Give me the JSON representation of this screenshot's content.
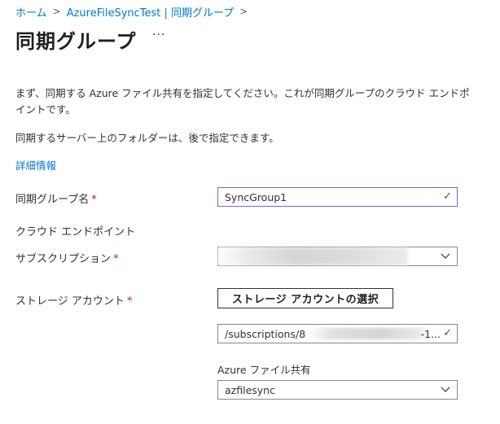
{
  "breadcrumb": {
    "items": [
      "ホーム",
      "AzureFileSyncTest | 同期グループ"
    ]
  },
  "page": {
    "title": "同期グループ",
    "more_label": "···"
  },
  "description": {
    "line1": "まず、同期する Azure ファイル共有を指定してください。これが同期グループのクラウド エンドポイントです。",
    "line2": "同期するサーバー上のフォルダーは、後で指定できます。",
    "learn_more": "詳細情報"
  },
  "form": {
    "sync_group_name_label": "同期グループ名",
    "sync_group_name_value": "SyncGroup1",
    "cloud_endpoint_heading": "クラウド エンドポイント",
    "subscription_label": "サブスクリプション",
    "subscription_value": "",
    "storage_account_label": "ストレージ アカウント",
    "select_storage_button": "ストレージ アカウントの選択",
    "storage_account_path_start": "/subscriptions/8",
    "storage_account_path_end": "-1...",
    "file_share_label": "Azure ファイル共有",
    "file_share_value": "azfilesync",
    "required_marker": "*"
  },
  "colors": {
    "link": "#0078d4",
    "required": "#a4262c",
    "valid_check": "#107c10",
    "focus_border": "#8661c5"
  }
}
